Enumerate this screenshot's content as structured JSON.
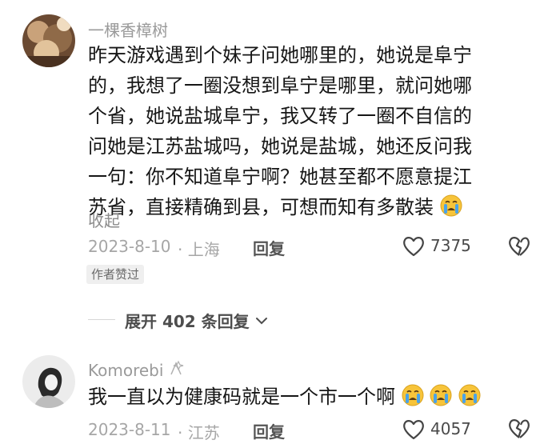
{
  "comment1": {
    "username": "一棵香樟树",
    "lines": [
      "昨天游戏遇到个妹子问她哪里的，她说是阜宁",
      "的，我想了一圈没想到阜宁是哪里，就问她哪",
      "个省，她说盐城阜宁，我又转了一圈不自信的",
      "问她是江苏盐城吗，她说是盐城，她还反问我",
      "一句：你不知道阜宁啊？她甚至都不愿意提江",
      "苏省，直接精确到县，可想而知有多散装"
    ],
    "emoji": "crying-face",
    "collapse_label": "收起",
    "date": "2023-8-10",
    "location": "· 上海",
    "reply_label": "回复",
    "like_count": "7375",
    "badge": "作者赞过"
  },
  "expand_replies": "展开 402 条回复",
  "comment2": {
    "username": "Komorebi",
    "text": "我一直以为健康码就是一个市一个啊",
    "emojis": [
      "crying-face",
      "crying-face",
      "crying-face"
    ],
    "date": "2023-8-11",
    "location": "· 江苏",
    "reply_label": "回复",
    "like_count": "4057"
  },
  "colors": {
    "text": "#161616",
    "meta": "#a6a6a6",
    "emoji_yellow": "#f7c43a",
    "emoji_tear": "#4aa3e8"
  }
}
